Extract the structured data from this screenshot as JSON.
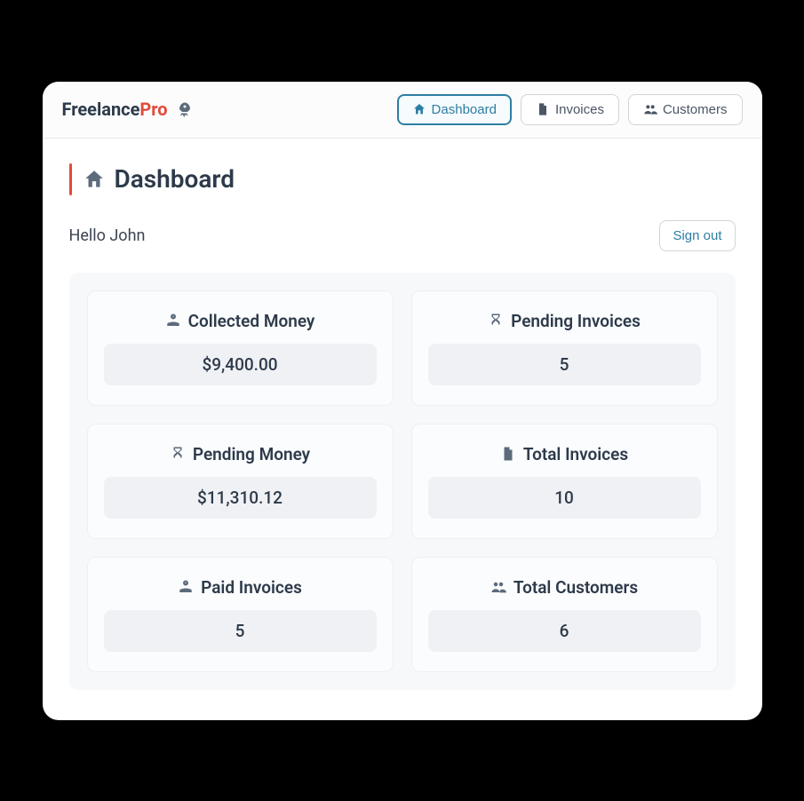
{
  "brand": {
    "part1": "Freelance",
    "part2": "Pro"
  },
  "nav": {
    "dashboard": "Dashboard",
    "invoices": "Invoices",
    "customers": "Customers"
  },
  "page": {
    "title": "Dashboard"
  },
  "greeting": "Hello John",
  "signout": "Sign out",
  "cards": {
    "collected_money": {
      "label": "Collected Money",
      "value": "$9,400.00"
    },
    "pending_invoices": {
      "label": "Pending Invoices",
      "value": "5"
    },
    "pending_money": {
      "label": "Pending Money",
      "value": "$11,310.12"
    },
    "total_invoices": {
      "label": "Total Invoices",
      "value": "10"
    },
    "paid_invoices": {
      "label": "Paid Invoices",
      "value": "5"
    },
    "total_customers": {
      "label": "Total Customers",
      "value": "6"
    }
  }
}
